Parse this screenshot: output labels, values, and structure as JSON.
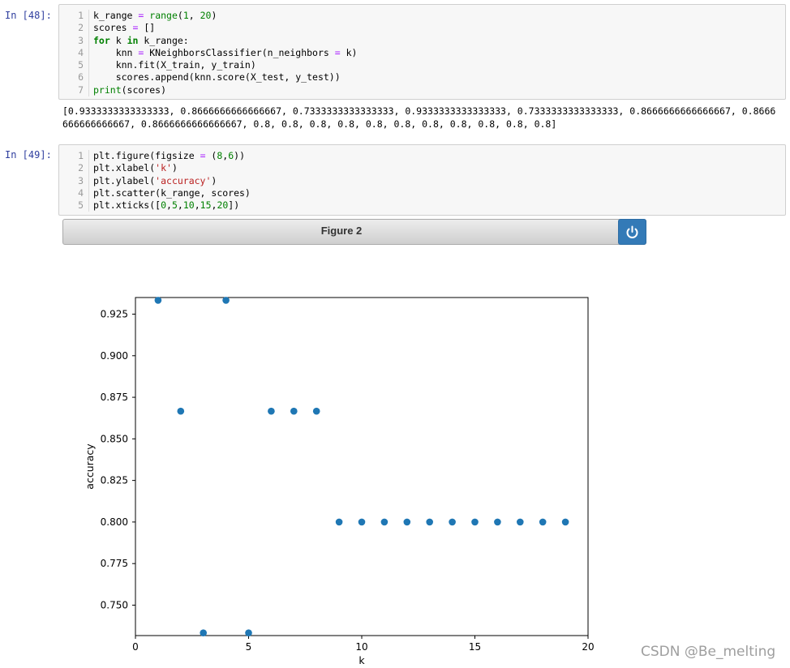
{
  "cell48": {
    "prompt": "In  [48]:",
    "lines": [
      {
        "no": "1",
        "html": "k_range <span class=\"op\">=</span> <span class=\"bi\">range</span>(<span class=\"num\">1</span>, <span class=\"num\">20</span>)"
      },
      {
        "no": "2",
        "html": "scores <span class=\"op\">=</span> []"
      },
      {
        "no": "3",
        "html": "<span class=\"kw\">for</span> k <span class=\"kw\">in</span> k_range:"
      },
      {
        "no": "4",
        "html": "    knn <span class=\"op\">=</span> KNeighborsClassifier(n_neighbors <span class=\"op\">=</span> k)"
      },
      {
        "no": "5",
        "html": "    knn.fit(X_train, y_train)"
      },
      {
        "no": "6",
        "html": "    scores.append(knn.score(X_test, y_test))"
      },
      {
        "no": "7",
        "html": "<span class=\"bi\">print</span>(scores)"
      }
    ],
    "output": "[0.9333333333333333, 0.8666666666666667, 0.7333333333333333, 0.9333333333333333, 0.7333333333333333, 0.8666666666666667, 0.8666666666666667, 0.8666666666666667, 0.8, 0.8, 0.8, 0.8, 0.8, 0.8, 0.8, 0.8, 0.8, 0.8, 0.8]"
  },
  "cell49": {
    "prompt": "In  [49]:",
    "lines": [
      {
        "no": "1",
        "html": "plt.figure(figsize <span class=\"op\">=</span> (<span class=\"num\">8</span>,<span class=\"num\">6</span>))"
      },
      {
        "no": "2",
        "html": "plt.xlabel(<span class=\"str\">'k'</span>)"
      },
      {
        "no": "3",
        "html": "plt.ylabel(<span class=\"str\">'accuracy'</span>)"
      },
      {
        "no": "4",
        "html": "plt.scatter(k_range, scores)"
      },
      {
        "no": "5",
        "html": "plt.xticks([<span class=\"num\">0</span>,<span class=\"num\">5</span>,<span class=\"num\">10</span>,<span class=\"num\">15</span>,<span class=\"num\">20</span>])"
      }
    ]
  },
  "figure": {
    "title": "Figure 2",
    "button_icon": "power-icon"
  },
  "chart_data": {
    "type": "scatter",
    "x": [
      1,
      2,
      3,
      4,
      5,
      6,
      7,
      8,
      9,
      10,
      11,
      12,
      13,
      14,
      15,
      16,
      17,
      18,
      19
    ],
    "y": [
      0.9333333333333333,
      0.8666666666666667,
      0.7333333333333333,
      0.9333333333333333,
      0.7333333333333333,
      0.8666666666666667,
      0.8666666666666667,
      0.8666666666666667,
      0.8,
      0.8,
      0.8,
      0.8,
      0.8,
      0.8,
      0.8,
      0.8,
      0.8,
      0.8,
      0.8
    ],
    "xlabel": "k",
    "ylabel": "accuracy",
    "xticks": [
      0,
      5,
      10,
      15,
      20
    ],
    "yticks": [
      "0.750",
      "0.775",
      "0.800",
      "0.825",
      "0.850",
      "0.875",
      "0.900",
      "0.925"
    ],
    "xlim": [
      0,
      20
    ],
    "ylim": [
      0.7317,
      0.935
    ],
    "color": "#1f77b4"
  },
  "watermark": "CSDN @Be_melting"
}
